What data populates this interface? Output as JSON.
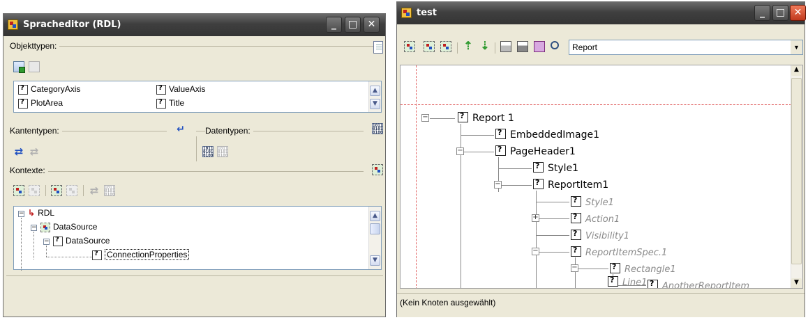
{
  "left_window": {
    "title": "Spracheditor (RDL)",
    "controls": {
      "minimize": "_",
      "maximize": "□",
      "close": "✕"
    },
    "objekttypen": {
      "label": "Objekttypen:",
      "items": [
        "CategoryAxis",
        "ValueAxis",
        "PlotArea",
        "Title"
      ]
    },
    "kantentypen": {
      "label": "Kantentypen:"
    },
    "datentypen": {
      "label": "Datentypen:"
    },
    "kontexte": {
      "label": "Kontexte:",
      "tree": [
        "RDL",
        "DataSource",
        "DataSource",
        "ConnectionProperties"
      ]
    },
    "icons": {
      "binary": "1011\n0101\n0100"
    }
  },
  "right_window": {
    "title": "test",
    "controls": {
      "minimize": "_",
      "maximize": "□",
      "close": "✕"
    },
    "toolbar": {
      "combo_value": "Report",
      "combo_arrow": "▼"
    },
    "tree": [
      {
        "label": "Report 1",
        "style": "normal"
      },
      {
        "label": "EmbeddedImage1",
        "style": "normal"
      },
      {
        "label": "PageHeader1",
        "style": "normal"
      },
      {
        "label": "Style1",
        "style": "normal"
      },
      {
        "label": "ReportItem1",
        "style": "normal"
      },
      {
        "label": "Style1",
        "style": "italic"
      },
      {
        "label": "Action1",
        "style": "italic"
      },
      {
        "label": "Visibility1",
        "style": "italic"
      },
      {
        "label": "ReportItemSpec.1",
        "style": "italic"
      },
      {
        "label": "Rectangle1",
        "style": "italic"
      },
      {
        "label": "AnotherReportItem",
        "style": "italic"
      },
      {
        "label": "Line1",
        "style": "italic"
      }
    ],
    "status": "(Kein Knoten ausgewählt)"
  },
  "glyphs": {
    "minus": "−",
    "plus": "+",
    "up": "▲",
    "down": "▼",
    "up_arrow": "⇡",
    "down_arrow": "⇣"
  }
}
